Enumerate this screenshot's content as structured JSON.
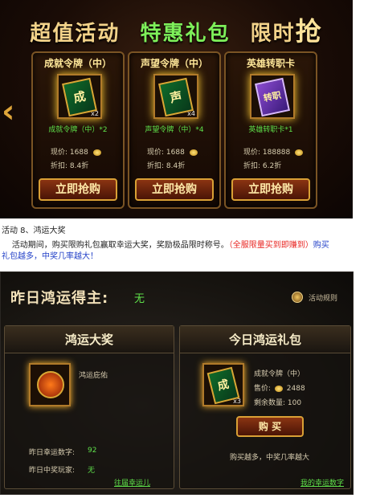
{
  "banner": {
    "headline": {
      "part1": "超值活动",
      "part2": "特惠礼包",
      "part3a": "限时",
      "part3b": "抢"
    },
    "arrow": "‹",
    "cards": [
      {
        "title": "成就令牌（中）",
        "token": "成",
        "qty": "x2",
        "name": "成就令牌（中）*2",
        "price": "现价: 1688",
        "discount": "折扣: 8.4折",
        "buy": "立即抢购"
      },
      {
        "title": "声望令牌（中）",
        "token": "声",
        "qty": "x4",
        "name": "声望令牌（中）*4",
        "price": "现价: 1688",
        "discount": "折扣: 8.4折",
        "buy": "立即抢购"
      },
      {
        "title": "英雄转职卡",
        "token": "转职",
        "qty": "",
        "name": "英雄转职卡*1",
        "price": "现价: 188888",
        "discount": "折扣: 6.2折",
        "buy": "立即抢购"
      }
    ]
  },
  "activity": {
    "heading": "活动 8、鸿运大奖",
    "desc": "活动期间，购买限购礼包赢取幸运大奖，奖励极品限时称号。",
    "note": "（全服限量买到即赚到）",
    "tail1": "购买",
    "tail2": "礼包越多，中奖几率越大！"
  },
  "panel": {
    "header": "昨日鸿运得主:",
    "header_value": "无",
    "rules": "活动规则",
    "left": {
      "title": "鸿运大奖",
      "item_name": "鸿运庇佑",
      "lucky_label": "昨日幸运数字:",
      "lucky_value": "92",
      "winner_label": "昨日中奖玩家:",
      "winner_value": "无",
      "link": "往届幸运儿"
    },
    "right": {
      "title": "今日鸿运礼包",
      "token": "成",
      "qty": "x3",
      "name": "成就令牌（中）",
      "price_label": "售价:",
      "price": "2488",
      "remain": "剩余数量: 100",
      "buy": "购 买",
      "note": "购买越多，中奖几率越大",
      "link": "我的幸运数字"
    }
  }
}
